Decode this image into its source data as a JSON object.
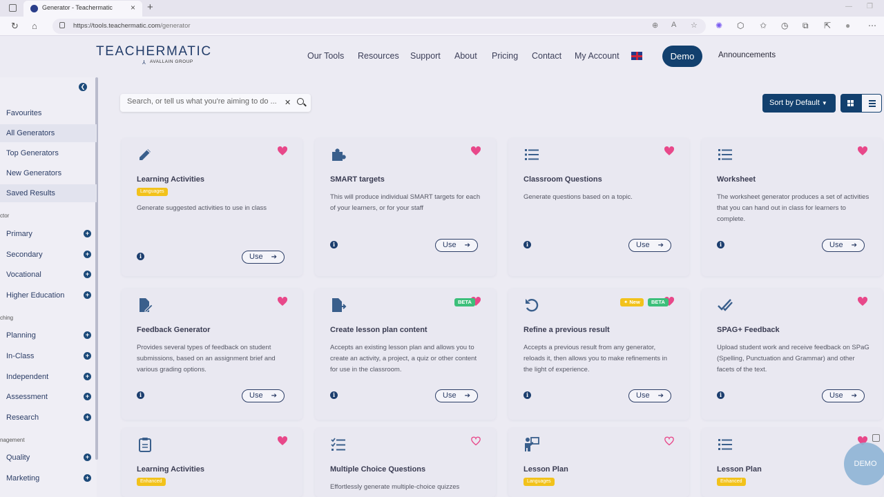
{
  "browser": {
    "tab_title": "Generator - Teachermatic",
    "url_host": "https://tools.teachermatic.com",
    "url_path": "/generator"
  },
  "header": {
    "logo": "TEACHERMATIC",
    "logo_sub": "AVALLAIN GROUP",
    "nav": [
      "Our Tools",
      "Resources",
      "Support",
      "About",
      "Pricing",
      "Contact",
      "My Account"
    ],
    "demo": "Demo",
    "announcements": "Announcements"
  },
  "sidebar": {
    "items": [
      "Favourites",
      "All Generators",
      "Top Generators",
      "New Generators",
      "Saved Results"
    ],
    "sections": [
      {
        "heading": "ctor",
        "items": [
          "Primary",
          "Secondary",
          "Vocational",
          "Higher Education"
        ]
      },
      {
        "heading": "ching",
        "items": [
          "Planning",
          "In-Class",
          "Independent",
          "Assessment",
          "Research"
        ]
      },
      {
        "heading": "nagement",
        "items": [
          "Quality",
          "Marketing"
        ]
      }
    ]
  },
  "search": {
    "placeholder": "Search, or tell us what you're aiming to do ..."
  },
  "sort": {
    "label": "Sort by Default"
  },
  "colors": {
    "primary": "#12406e",
    "heart": "#e8488a",
    "tag": "#f2c21b",
    "beta": "#3cbf7a"
  },
  "cards": [
    {
      "title": "Learning Activities",
      "tag": "Languages",
      "desc": "Generate suggested activities to use in class",
      "use": "Use",
      "icon": "pencil-icon",
      "fav": true
    },
    {
      "title": "SMART targets",
      "desc": "This will produce individual SMART targets for each of your learners, or for your staff",
      "use": "Use",
      "icon": "puzzle-icon",
      "fav": true
    },
    {
      "title": "Classroom Questions",
      "desc": "Generate questions based on a topic.",
      "use": "Use",
      "icon": "list-icon",
      "fav": true
    },
    {
      "title": "Worksheet",
      "desc": "The worksheet generator produces a set of activities that you can hand out in class for learners to complete.",
      "use": "Use",
      "icon": "list-icon",
      "fav": true
    },
    {
      "title": "Feedback Generator",
      "desc": "Provides several types of feedback on student submissions, based on an assignment brief and various grading options.",
      "use": "Use",
      "icon": "file-edit-icon",
      "fav": true
    },
    {
      "title": "Create lesson plan content",
      "badge_beta": "BETA",
      "desc": "Accepts an existing lesson plan and allows you to create an activity, a project, a quiz or other content for use in the classroom.",
      "use": "Use",
      "icon": "file-export-icon",
      "fav": true
    },
    {
      "title": "Refine a previous result",
      "badge_new": "✦ New",
      "badge_beta": "BETA",
      "desc": "Accepts a previous result from any generator, reloads it, then allows you to make refinements in the light of experience.",
      "use": "Use",
      "icon": "undo-icon",
      "fav": true
    },
    {
      "title": "SPAG+ Feedback",
      "desc": "Upload student work and receive feedback on SPaG (Spelling, Punctuation and Grammar) and other facets of the text.",
      "use": "Use",
      "icon": "double-check-icon",
      "fav": true
    },
    {
      "title": "Learning Activities",
      "tag": "Enhanced",
      "desc": "",
      "icon": "clipboard-icon",
      "fav": true
    },
    {
      "title": "Multiple Choice Questions",
      "desc": "Effortlessly generate multiple-choice quizzes",
      "icon": "checklist-icon",
      "fav": false
    },
    {
      "title": "Lesson Plan",
      "tag": "Languages",
      "desc": "",
      "icon": "teacher-icon",
      "fav": false
    },
    {
      "title": "Lesson Plan",
      "tag": "Enhanced",
      "desc": "",
      "icon": "list-icon",
      "fav": true
    }
  ],
  "floating": {
    "demo": "DEMO"
  }
}
